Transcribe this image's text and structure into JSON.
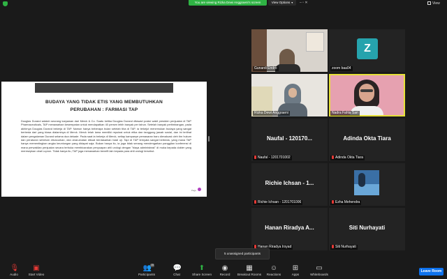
{
  "top": {
    "banner": "You are viewing Rizka Dewi Anggraeni's screen",
    "view_options": "View Options",
    "view_label": "View"
  },
  "slide": {
    "title_line1": "BUDAYA YANG TIDAK ETIS YANG MEMBUTUHKAN",
    "title_line2": "PERUBAHAN : FARMASI TAP",
    "body": "Douglas Durand adalah seorang karyawan dari Merck & Co. Suatu ketika Douglas Durand ditawari posisi wakil presiden penjualan di TAP Pharmaceuticals, TAP menawarkan kesempatan untuk mendapatkan 40 persen lebih banyak per tahun. Setelah banyak pertimbangan, pada akhirnya Douglas Durand bekerja di TAP. Namun hanya beberapa bulan setelah tiba di TAP, ia terkejut menemukan budaya yang sangat berbeda dari yang biasa dialaminya di Merck. Merck telah lama memiliki reputasi untuk etika dan tanggung jawab sosial, dan ini terlihat dalam pengalaman Durand selama dua dekade. Pada saat ia bekerja di Merck, setiap kampanye pemasaran baru dievaluasi oleh tim hukum dan peraturan sebelum diluncurkan, dan obat-obatan dibuat berdasarkan hasil uji. Tapi di TAP ternyata sangat berbeda, yang mana TAP hanya mementingkan angka keuntungan yang didapat saja. Bukan hanya itu, ia juga tidak senang mendengarkan panggilan konferensi di mana perwakilan penjualan secara terbuka membicarakan penyuapan ahli urologi dengan \"biaya administrasi\" di muka kepada dokter yang meresepkan obat Lupron. Tidak hanya itu, TAP juga menawarkan benefit lain kepada para ahli urologi tersebut.",
    "page_label": "Page"
  },
  "participants_tiles": [
    {
      "name": "Gunardi Endro",
      "type": "video"
    },
    {
      "name": "zoom baa04",
      "type": "avatar",
      "initial": "Z",
      "color": "#26a3ad"
    },
    {
      "name": "Rizka Dewi Anggraeni",
      "type": "video"
    },
    {
      "name": "Nadra Fahla Sari",
      "type": "video",
      "speaking": true
    },
    {
      "name": "Naufal - 1201701002",
      "big": "Naufal - 120170...",
      "muted": true
    },
    {
      "name": "Adinda Okta Tiara",
      "big": "Adinda Okta Tiara",
      "muted": true
    },
    {
      "name": "Richie Ichsan - 1201701006",
      "big": "Richie Ichsan - 1...",
      "muted": true
    },
    {
      "name": "Ezha Mehendra",
      "type": "image",
      "muted": true
    },
    {
      "name": "Hanan Riradya Irsyad",
      "big": "Hanan Riradya A...",
      "muted": true
    },
    {
      "name": "Siti Nurhayati",
      "big": "Siti Nurhayati",
      "muted": true
    }
  ],
  "tooltip": "5 unassigned participants",
  "toolbar": {
    "audio": "Audio",
    "start_video": "Start Video",
    "participants": "Participants",
    "participants_count": "15",
    "chat": "Chat",
    "share_screen": "Share Screen",
    "record": "Record",
    "breakout_rooms": "Breakout Rooms",
    "reactions": "Reactions",
    "apps": "Apps",
    "whiteboards": "Whiteboards",
    "leave_room": "Leave Room"
  },
  "colors": {
    "banner": "#2fb344",
    "speaking_border": "#e6e038",
    "leave_button": "#0e72ed",
    "share_icon": "#2fb344",
    "mute_red": "#e53935"
  }
}
